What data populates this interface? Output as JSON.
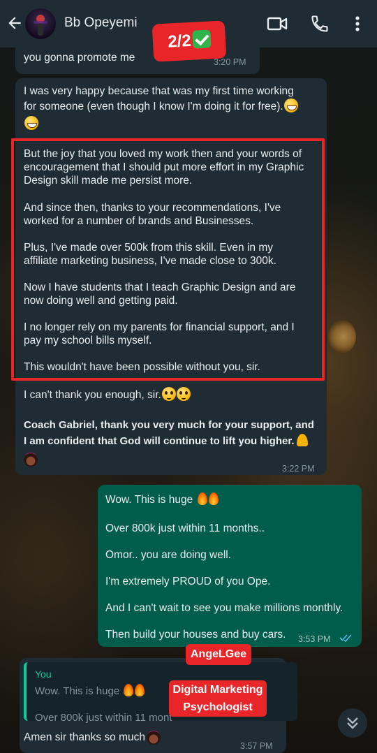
{
  "header": {
    "contact_name": "Bb Opeyemi",
    "icons": [
      "back-arrow-icon",
      "video-call-icon",
      "phone-icon",
      "more-options-icon"
    ]
  },
  "stickers": {
    "page_indicator": "2/2",
    "angel_label": "AngeLGee",
    "title_line1": "Digital Marketing",
    "title_line2": "Psychologist"
  },
  "messages": {
    "m1": {
      "text": "you gonna promote me",
      "time": "3:20 PM"
    },
    "m2": {
      "line1": "I was very happy because that was my first time working",
      "line2": "for someone (even though I know I'm doing it for free).",
      "p1_l1": "But the joy that you loved my work then and your words of",
      "p1_l2": "encouragement that I should put more effort in my Graphic",
      "p1_l3": "Design skill made me persist more.",
      "p2_l1": "And since then, thanks to your recommendations, I've",
      "p2_l2": "worked for a number of brands and Businesses.",
      "p3_l1": "Plus, I've made over 500k from this skill. Even in my",
      "p3_l2": "affiliate marketing business, I've made close to 300k.",
      "p4_l1": "Now I have students that I teach Graphic Design and are",
      "p4_l2": "now doing well and getting paid.",
      "p5_l1": "I no longer rely on my parents for financial support, and I",
      "p5_l2": "pay my school bills myself.",
      "p6": "This wouldn't have been possible without you, sir.",
      "p7": "I can't thank you enough, sir.",
      "p8_l1": "Coach Gabriel, thank you very much for your support, and",
      "p8_l2": "I am confident that God will continue to lift you higher.",
      "time": "3:22 PM"
    },
    "m3": {
      "l1": "Wow. This is huge",
      "l2": "Over 800k just within 11 months..",
      "l3": "Omor.. you are doing well.",
      "l4": "I'm extremely PROUD of you Ope.",
      "l5": "And I can't wait to see you make millions monthly.",
      "l6": "Then build your houses and buy cars.",
      "time": "3:53 PM",
      "status": "read"
    },
    "m4": {
      "quote_author": "You",
      "quote_line1": "Wow. This is huge",
      "quote_line2": "Over 800k just within 11 mont",
      "text": "Amen sir thanks so much",
      "time": "3:57 PM"
    }
  },
  "colors": {
    "header_bg": "#1f2c33",
    "incoming_bubble": "#1f2c33",
    "outgoing_bubble": "#005c4b",
    "highlight_red": "#e8262a",
    "read_ticks": "#53bdeb",
    "quote_accent": "#06cf9c"
  }
}
